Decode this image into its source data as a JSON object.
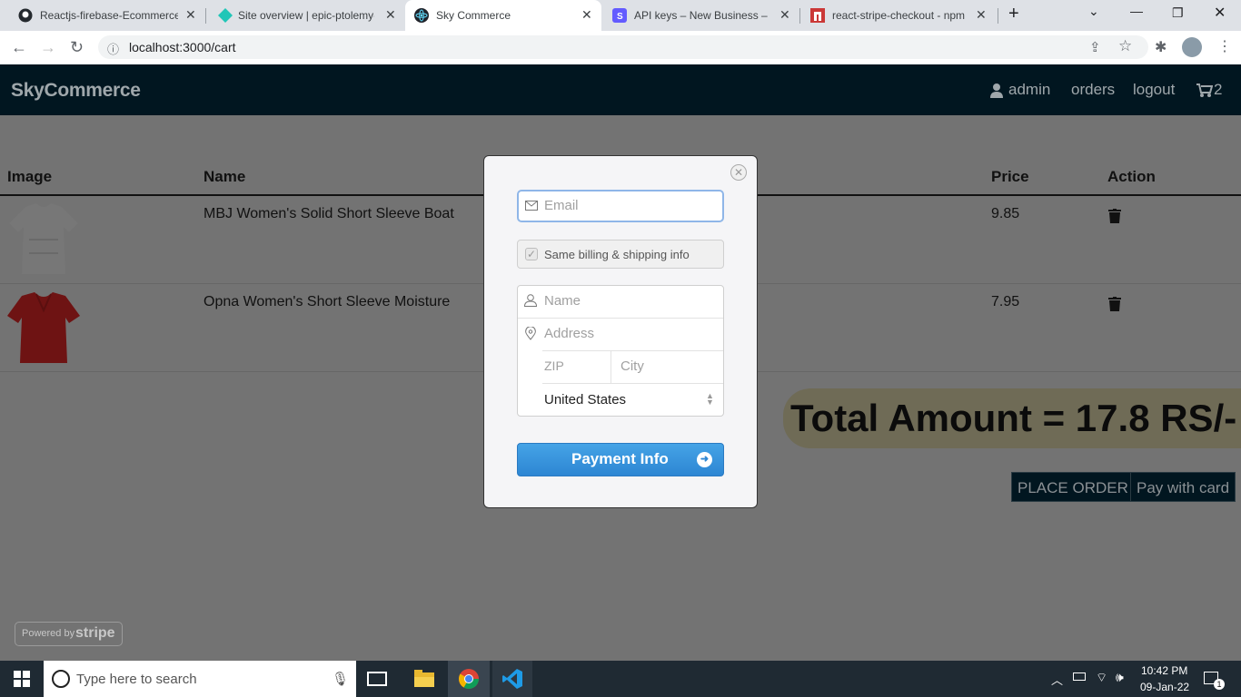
{
  "browser": {
    "tabs": [
      {
        "title": "Reactjs-firebase-Ecommerce-"
      },
      {
        "title": "Site overview | epic-ptolemy-"
      },
      {
        "title": "Sky Commerce"
      },
      {
        "title": "API keys – New Business – St"
      },
      {
        "title": "react-stripe-checkout - npm"
      }
    ],
    "url": "localhost:3000/cart"
  },
  "navbar": {
    "brand": "SkyCommerce",
    "user": "admin",
    "orders": "orders",
    "logout": "logout",
    "cart_count": "2"
  },
  "cart": {
    "headers": {
      "image": "Image",
      "name": "Name",
      "price": "Price",
      "action": "Action"
    },
    "items": [
      {
        "name": "MBJ Women's Solid Short Sleeve Boat",
        "price": "9.85"
      },
      {
        "name": "Opna Women's Short Sleeve Moisture",
        "price": "7.95"
      }
    ],
    "total": "Total Amount = 17.8 RS/-",
    "place_order": "PLACE ORDER",
    "pay_with_card": "Pay with card"
  },
  "stripe_modal": {
    "email_placeholder": "Email",
    "same_billing_label": "Same billing & shipping info",
    "name_placeholder": "Name",
    "address_placeholder": "Address",
    "zip_placeholder": "ZIP",
    "city_placeholder": "City",
    "country": "United States",
    "pay_button": "Payment Info"
  },
  "stripe_badge": {
    "powered": "Powered by",
    "brand": "stripe"
  },
  "taskbar": {
    "search_placeholder": "Type here to search",
    "time": "10:42 PM",
    "date": "09-Jan-22",
    "notifications": "1"
  }
}
